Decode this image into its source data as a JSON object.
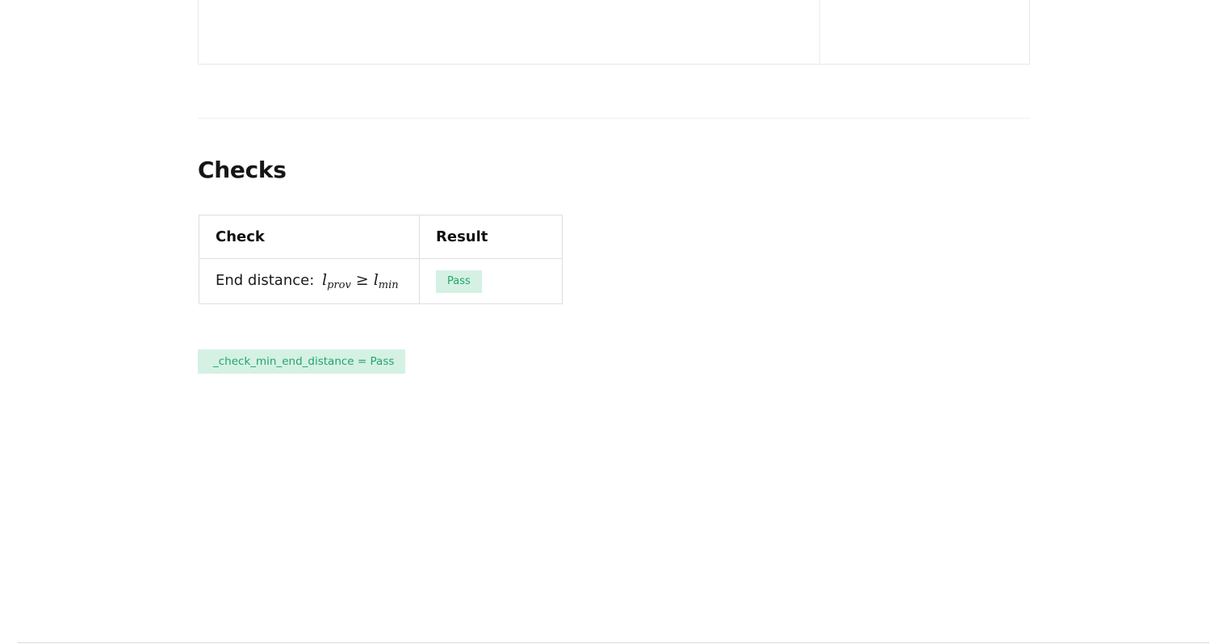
{
  "checks_section": {
    "title": "Checks",
    "table": {
      "headers": [
        "Check",
        "Result"
      ],
      "rows": [
        {
          "check_label": "End distance:",
          "formula": {
            "lhs": "l",
            "lhs_sub": "prov",
            "operator": "≥",
            "rhs": "l",
            "rhs_sub": "min"
          },
          "result": "Pass"
        }
      ]
    }
  },
  "result_badge": "_check_min_end_distance = Pass",
  "colors": {
    "pass_background": "#d4f1e4",
    "pass_text": "#23a56a"
  }
}
